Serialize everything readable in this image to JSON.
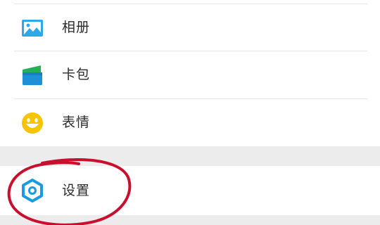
{
  "menu": {
    "items": [
      {
        "label": "相册",
        "icon": "photo-album-icon"
      },
      {
        "label": "卡包",
        "icon": "card-wallet-icon"
      },
      {
        "label": "表情",
        "icon": "emoji-smiley-icon"
      }
    ],
    "settings": {
      "label": "设置",
      "icon": "gear-icon"
    }
  },
  "colors": {
    "album_icon": "#2FA8E6",
    "card_icon_green": "#22B05A",
    "card_icon_blue": "#1E90D8",
    "emoji_icon": "#F7C400",
    "gear_icon": "#1A9BE0",
    "annotation_circle": "#C8102E",
    "section_gap": "#ECECEC"
  }
}
